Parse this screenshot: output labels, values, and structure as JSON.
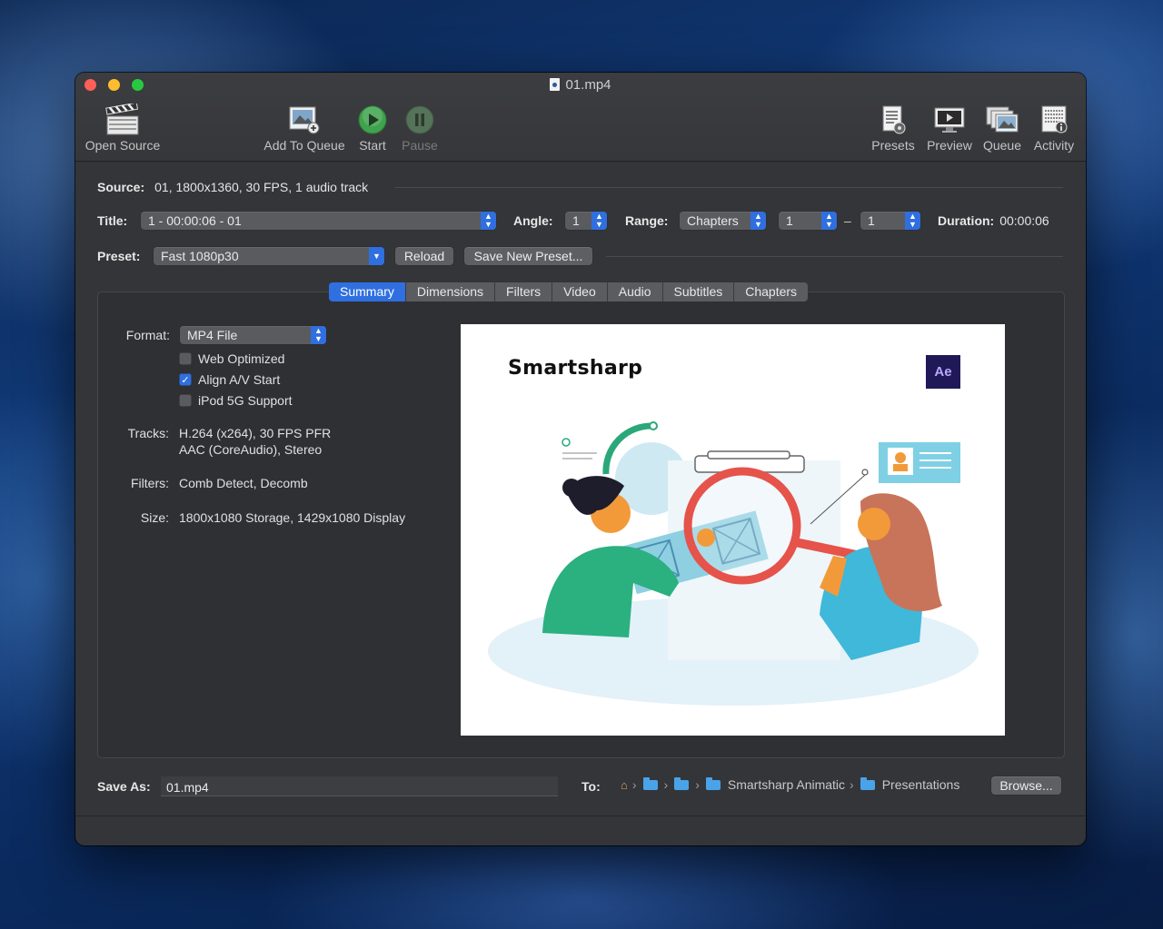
{
  "window": {
    "title": "01.mp4"
  },
  "toolbar": {
    "open_source": "Open Source",
    "add_to_queue": "Add To Queue",
    "start": "Start",
    "pause": "Pause",
    "presets": "Presets",
    "preview": "Preview",
    "queue": "Queue",
    "activity": "Activity"
  },
  "source": {
    "label": "Source:",
    "value": "01, 1800x1360, 30 FPS, 1 audio track"
  },
  "title_row": {
    "title_label": "Title:",
    "title_value": "1 - 00:00:06 - 01",
    "angle_label": "Angle:",
    "angle_value": "1",
    "range_label": "Range:",
    "range_type": "Chapters",
    "range_start": "1",
    "range_dash": "–",
    "range_end": "1",
    "duration_label": "Duration:",
    "duration_value": "00:00:06"
  },
  "preset_row": {
    "preset_label": "Preset:",
    "preset_value": "Fast 1080p30",
    "reload": "Reload",
    "save_new_preset": "Save New Preset..."
  },
  "tabs": [
    "Summary",
    "Dimensions",
    "Filters",
    "Video",
    "Audio",
    "Subtitles",
    "Chapters"
  ],
  "summary": {
    "format_label": "Format:",
    "format_value": "MP4 File",
    "web_optimized": "Web Optimized",
    "web_optimized_checked": false,
    "align_av": "Align A/V Start",
    "align_av_checked": true,
    "ipod": "iPod 5G Support",
    "ipod_checked": false,
    "tracks_label": "Tracks:",
    "tracks_line1": "H.264 (x264), 30 FPS PFR",
    "tracks_line2": "AAC (CoreAudio), Stereo",
    "filters_label": "Filters:",
    "filters_value": "Comb Detect, Decomb",
    "size_label": "Size:",
    "size_value": "1800x1080 Storage, 1429x1080 Display"
  },
  "preview_image": {
    "brand": "Smartsharp",
    "badge": "Ae"
  },
  "save": {
    "label": "Save As:",
    "value": "01.mp4",
    "to_label": "To:",
    "path_folder1": "Smartsharp Animatic",
    "path_folder2": "Presentations",
    "browse": "Browse..."
  },
  "colors": {
    "accent": "#2f6fe0",
    "window_bg": "#343539",
    "start_green": "#3fa34d"
  }
}
